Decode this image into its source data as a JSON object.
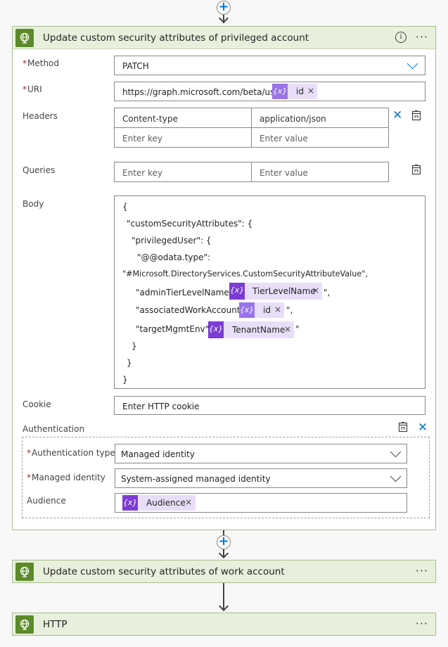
{
  "action1": {
    "title": "Update custom security attributes of privileged account",
    "info_icon": "info-icon",
    "more_label": "···",
    "method": {
      "label": "Method",
      "value": "PATCH"
    },
    "uri": {
      "label": "URI",
      "value": "https://graph.microsoft.com/beta/users/",
      "token": {
        "icon": "{x}",
        "label": "id",
        "remove": "×"
      }
    },
    "headers": {
      "label": "Headers",
      "rows": [
        {
          "key": "Content-type",
          "value": "application/json"
        }
      ],
      "key_placeholder": "Enter key",
      "value_placeholder": "Enter value"
    },
    "queries": {
      "label": "Queries",
      "key_placeholder": "Enter key",
      "value_placeholder": "Enter value"
    },
    "body": {
      "label": "Body",
      "lines": [
        "{",
        "\"customSecurityAttributes\": {",
        "\"privilegedUser\": {",
        "\"@@odata.type\":",
        "\"#Microsoft.DirectoryServices.CustomSecurityAttributeValue\","
      ],
      "admin_prefix": "\"adminTierLevelName\": \"",
      "admin_token": "TierLevelName",
      "admin_suffix": "\",",
      "assoc_prefix": "\"associatedWorkAccount\": \"",
      "assoc_token": "id",
      "assoc_suffix": "\",",
      "target_prefix": "\"targetMgmtEnv\": \"",
      "target_token": "TenantName",
      "target_suffix": "\"",
      "close1": "}",
      "close2": "}",
      "close3": "}",
      "token_icon": "{x}",
      "remove": "×"
    },
    "cookie": {
      "label": "Cookie",
      "placeholder": "Enter HTTP cookie"
    },
    "auth": {
      "label": "Authentication",
      "type_label": "Authentication type",
      "type_value": "Managed identity",
      "identity_label": "Managed identity",
      "identity_value": "System-assigned managed identity",
      "audience_label": "Audience",
      "audience_token": "Audience",
      "token_icon": "{x}",
      "remove": "×"
    },
    "required_mark": "*"
  },
  "action2": {
    "title": "Update custom security attributes of work account",
    "more_label": "···"
  },
  "action3": {
    "title": "HTTP",
    "more_label": "···"
  },
  "colors": {
    "accent": "#0078d4",
    "header_bg": "#e8f0dd",
    "token_icon": "#7c3bd4",
    "token_bg": "#e8def8",
    "icon_bg": "#5c8a2a"
  }
}
